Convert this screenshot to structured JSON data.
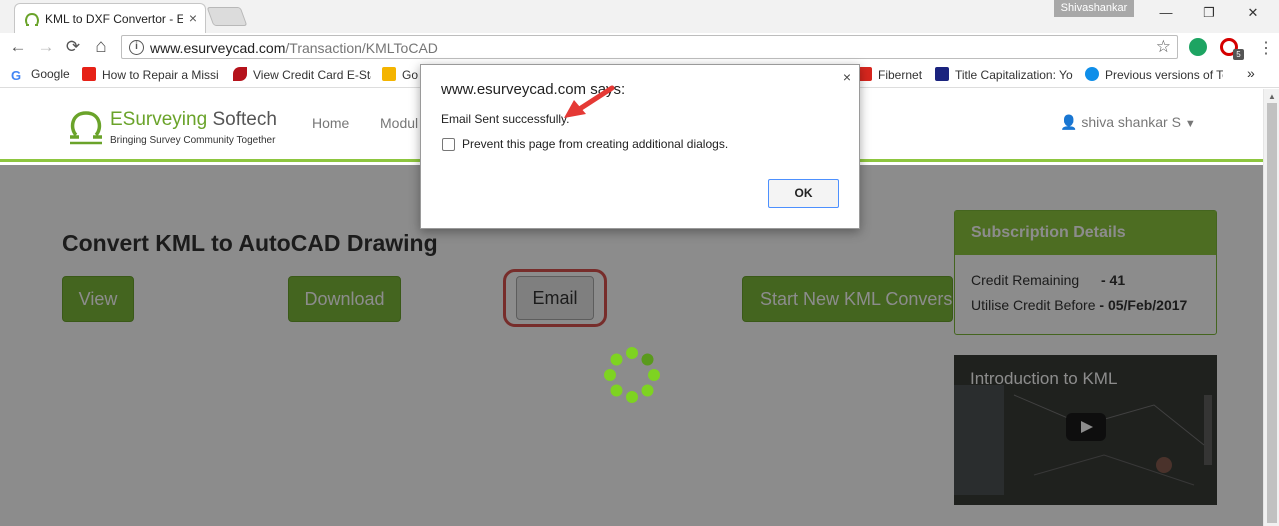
{
  "browser": {
    "tab_title": "KML to DXF Convertor - E",
    "tab_close": "×",
    "profile_name": "Shivashankar",
    "url_host": "www.esurveycad.com",
    "url_path": "/Transaction/KMLToCAD",
    "nav": {
      "back": "←",
      "forward": "→",
      "reload": "⟳",
      "home": "⌂",
      "star": "☆",
      "overflow": "»"
    },
    "window": {
      "minimize": "—",
      "restore": "❐",
      "close": "✕"
    },
    "extension_badge": "5",
    "bookmarks": [
      {
        "label": "Google",
        "icon": "google-icon",
        "color": "#4285f4"
      },
      {
        "label": "How to Repair a Missi",
        "icon": "youtube-icon",
        "color": "#e62117"
      },
      {
        "label": "View Credit Card E-Sta",
        "icon": "bank-icon",
        "color": "#b5121b"
      },
      {
        "label": "Go",
        "icon": "pencil-icon",
        "color": "#f4b400"
      },
      {
        "label": "Fibernet",
        "icon": "act-icon",
        "color": "#d7261e"
      },
      {
        "label": "Title Capitalization: Yo",
        "icon": "quote-icon",
        "color": "#1a237e"
      },
      {
        "label": "Previous versions of Te",
        "icon": "teamviewer-icon",
        "color": "#0e8ee9"
      }
    ]
  },
  "site": {
    "logo_name_part1": "ESurveying",
    "logo_name_part2": " Softech",
    "logo_tagline": "Bringing Survey Community Together",
    "nav": [
      "Home",
      "Modul"
    ],
    "user_name": "shiva shankar S",
    "brand_color": "#8dc63f"
  },
  "main": {
    "title": "Convert KML to AutoCAD Drawing",
    "buttons": {
      "view": "View",
      "download": "Download",
      "email": "Email",
      "start_new": "Start New KML Conversion"
    }
  },
  "subscription": {
    "heading": "Subscription Details",
    "credit_label": "Credit Remaining",
    "credit_value": "- 41",
    "utilise_label": "Utilise Credit Before",
    "utilise_value": "- 05/Feb/2017"
  },
  "video": {
    "title": "Introduction to KML"
  },
  "dialog": {
    "title": "www.esurveycad.com says:",
    "message": "Email Sent successfully.",
    "checkbox_label": "Prevent this page from creating additional dialogs.",
    "ok_label": "OK",
    "close": "×"
  }
}
